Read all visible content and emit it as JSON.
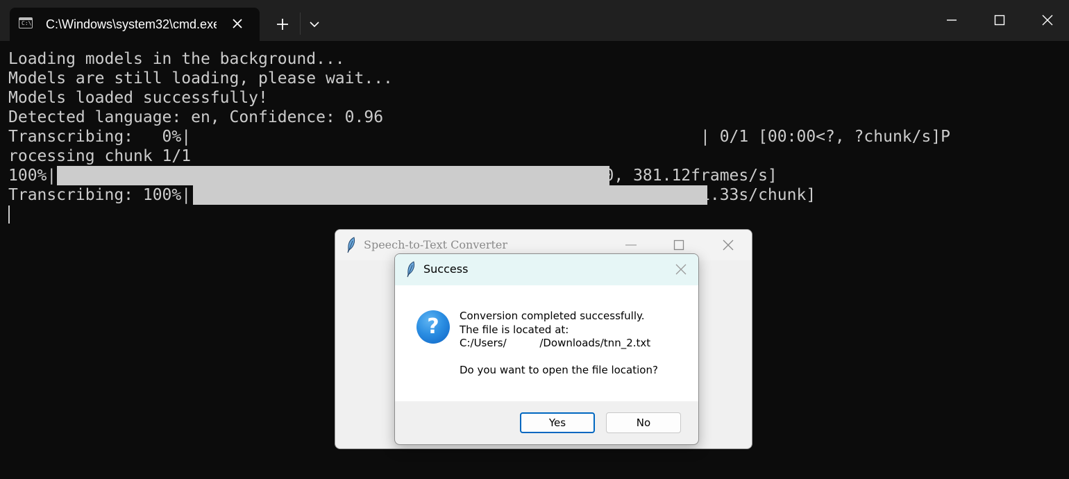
{
  "terminal": {
    "tab_title": "C:\\Windows\\system32\\cmd.exe",
    "tab_icon_text": "C:\\",
    "lines": [
      "Loading models in the background...",
      "Models are still loading, please wait...",
      "Models loaded successfully!",
      "Detected language: en, Confidence: 0.96",
      "Transcribing:   0%|                                                     | 0/1 [00:00<?, ?chunk/s]P",
      "rocessing chunk 1/1",
      "100%|                                | 22332/22332 [00:58<00:00, 381.12frames/s]",
      "Transcribing: 100%|                                | 1/1 [01:01<00:00, 61.33s/chunk]"
    ],
    "progress": [
      {
        "label": "Transcribing",
        "percent": 0
      },
      {
        "label": "frames",
        "percent": 100
      },
      {
        "label": "Transcribing",
        "percent": 100
      }
    ]
  },
  "app_window": {
    "title": "Speech-to-Text Converter"
  },
  "dialog": {
    "title": "Success",
    "message_lines": [
      "Conversion completed successfully.",
      "The file is located at:",
      "C:/Users/          /Downloads/tnn_2.txt",
      "",
      "Do you want to open the file location?"
    ],
    "icon_glyph": "?",
    "buttons": {
      "yes": "Yes",
      "no": "No"
    }
  },
  "colors": {
    "terminal_bg": "#0c0c0c",
    "terminal_text": "#cccccc",
    "titlebar_bg": "#202020",
    "dialog_titlebar_bg": "#e6f6f6",
    "default_button_border": "#0067c0",
    "question_icon": "#1a78d6"
  },
  "icons": [
    "terminal-icon",
    "close-icon",
    "plus-icon",
    "chevron-down-icon",
    "minimize-icon",
    "maximize-icon",
    "feather-icon",
    "question-icon"
  ]
}
